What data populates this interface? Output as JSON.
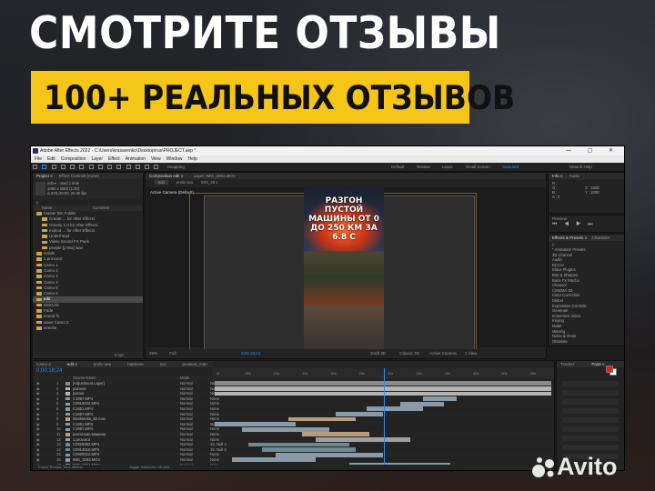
{
  "headline": "СМОТРИТЕ ОТЗЫВЫ",
  "banner": "100+ РЕАЛЬНЫХ ОТЗЫВОВ",
  "window": {
    "title": "Adobe After Effects 2022 - C:\\Users\\krasavenko\\Desktop\\rus\\PROJECT.aep *",
    "controls": "— ▢ ✕"
  },
  "menu": [
    "File",
    "Edit",
    "Composition",
    "Layer",
    "Effect",
    "Animation",
    "View",
    "Window",
    "Help"
  ],
  "toolbar": {
    "snapping": "Snapping",
    "workspaces": [
      "Default",
      "Review",
      "Learn",
      "Small Screen",
      "Standard"
    ],
    "active_workspace": "Standard",
    "search_placeholder": "Search Help"
  },
  "project": {
    "tab": "Project ≡",
    "tab2": "Effect Controls (none)",
    "preview_info": [
      "edit ▾ , used 1 time",
      "1080 x 1920 (1.00)",
      "Δ 0;01;25;00, 25.00 fps"
    ],
    "search_placeholder": "ρ",
    "col_name": "Name",
    "col_comment": "Comment",
    "items": [
      "Master Bin Folder",
      "Create ... for After Effects",
      "Gravity 1.0 for After Effects",
      "explod ... for After Effects",
      "Underhead",
      "Video Sound FX Pack",
      "people [j.mtw] wav",
      "Solids",
      "1.provorot",
      "Camo 1",
      "Camo 2",
      "Camo 3",
      "Camo 4",
      "Camo 5",
      "Camo 6",
      "edit",
      "EMOJIS",
      "Fade",
      "sound fx",
      "wave Camo 2",
      "wrecke"
    ],
    "selected_item": "edit",
    "footer": "8 bpc"
  },
  "composition": {
    "tab": "Composition edit ≡",
    "tab2": "Layer: IMG_3093.MOV",
    "breadcrumb": [
      "edit",
      "proliv sea",
      "IMG_39.1"
    ],
    "camera_label": "Active Camera (Default)",
    "video_text": "РАЗГОН ПУСТОЙ МАШИНЫ ОТ 0 ДО 250 КМ ЗА 6.8 С",
    "zoom": "29%",
    "resolution": "Full",
    "timecode": "0;00;18;24",
    "renderer": "Draft 3D",
    "view_mode": "Classic 3D",
    "camera": "Active Camera",
    "views": "1 View"
  },
  "info_panel": {
    "tabs": [
      "Info ≡",
      "Audio"
    ],
    "values": [
      "R :",
      "G :",
      "B :",
      "A : 0",
      "X : 1008",
      "Y : 1008"
    ],
    "preview_label": "Preview"
  },
  "effects": {
    "tab": "Effects & Presets ≡",
    "tab2": "Character",
    "search_placeholder": "ρ",
    "items": [
      "* Animation Presets",
      "3D Channel",
      "Audio",
      "BCCAI",
      "Blace PlugIns",
      "Blur & Sharpen",
      "Boris FX Mocha",
      "Channel",
      "CINEMA 4D",
      "Color Correction",
      "Distort",
      "Expression Controls",
      "Generate",
      "Immersive Video",
      "Keying",
      "Matte",
      "Missing",
      "Noise & Grain",
      "Obsolete"
    ]
  },
  "timeline": {
    "tabs": [
      "Camo 2",
      "edit ≡",
      "proliv sea",
      "hapborte",
      "rpo",
      "pooland_man",
      "1.provorot",
      "sound fx"
    ],
    "timecode": "0;00;18;24",
    "col_source": "Source Name",
    "col_mode": "Mode",
    "col_parent": "Parent & Link",
    "ruler_marks": [
      "0f",
      "05s",
      "10s",
      "15s",
      "20s",
      "25s",
      "30s",
      "35s",
      "40s",
      "45s",
      "50s",
      "55s",
      "01:00s"
    ],
    "layers": [
      {
        "n": "1",
        "name": "[Adjustment Layer]",
        "mode": "Normal",
        "parent": "None"
      },
      {
        "n": "2",
        "name": "pazover",
        "mode": "Normal",
        "parent": "None"
      },
      {
        "n": "3",
        "name": "pazow",
        "mode": "Normal",
        "parent": "None"
      },
      {
        "n": "4",
        "name": "C1657.MP4",
        "mode": "Normal",
        "parent": "None"
      },
      {
        "n": "5",
        "name": "C0919022.MP4",
        "mode": "Normal",
        "parent": "None"
      },
      {
        "n": "6",
        "name": "C1651.MP4",
        "mode": "Normal",
        "parent": "None"
      },
      {
        "n": "7",
        "name": "C1657.MP4",
        "mode": "Normal",
        "parent": "None"
      },
      {
        "n": "8",
        "name": "blanktanks_50.mov",
        "mode": "Normal",
        "parent": "None"
      },
      {
        "n": "9",
        "name": "C1651.MP4",
        "mode": "Normal",
        "parent": "None"
      },
      {
        "n": "10",
        "name": "C1657.MP4",
        "mode": "Normal",
        "parent": "None"
      },
      {
        "n": "11",
        "name": "разгонная машина",
        "mode": "Normal",
        "parent": "None"
      },
      {
        "n": "12",
        "name": "1.provorot",
        "mode": "Normal",
        "parent": "None"
      },
      {
        "n": "13",
        "name": "C0926852.MP4",
        "mode": "Normal",
        "parent": "15. Null 3"
      },
      {
        "n": "14",
        "name": "C0914910.MP4",
        "mode": "Normal",
        "parent": "15. Null 3"
      },
      {
        "n": "15",
        "name": "C0920012.MP4",
        "mode": "Normal",
        "parent": "None"
      },
      {
        "n": "16",
        "name": "IMG_3093.MOV",
        "mode": "Normal",
        "parent": "None"
      },
      {
        "n": "17",
        "name": "IMG_3094.MOV",
        "mode": "Normal",
        "parent": "None"
      },
      {
        "n": "18",
        "name": "pokroet.wav",
        "mode": "Normal",
        "parent": "None"
      }
    ],
    "footer": "Frame Render Time 465ms",
    "footer2": "Toggle Switches / Modes"
  },
  "right_bottom": {
    "tabs": [
      "Tracker",
      "Paint ≡"
    ]
  },
  "watermark": "Avito"
}
